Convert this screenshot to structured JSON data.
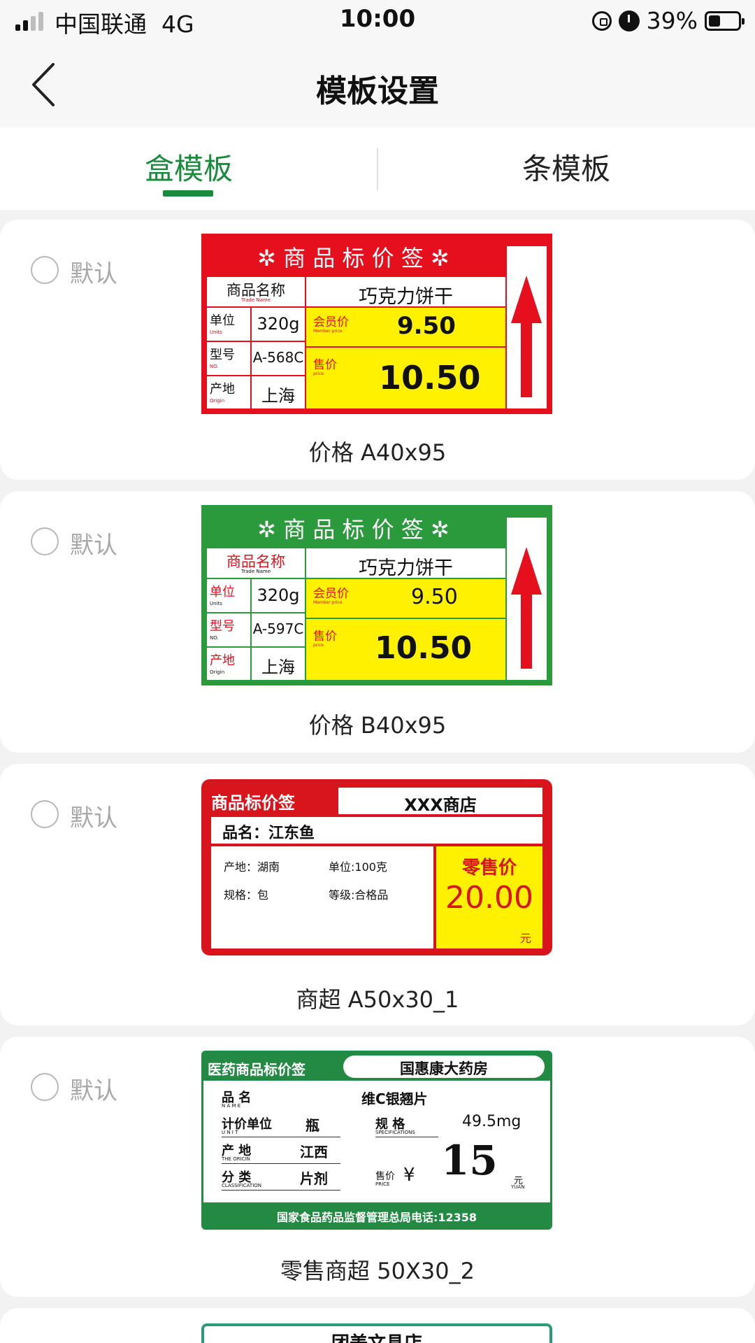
{
  "status_bar": {
    "carrier": "中国联通",
    "network": "4G",
    "time": "10:00",
    "battery": "39%",
    "battery_level": 0.39
  },
  "navbar": {
    "title": "模板设置"
  },
  "tabs": [
    {
      "label": "盒模板",
      "active": true
    },
    {
      "label": "条模板",
      "active": false
    }
  ],
  "radio_label": "默认",
  "templates": [
    {
      "name": "价格 A40x95",
      "label": {
        "header": "商 品 标 价 签",
        "product_name_label": "商品名称",
        "product_name_en": "Trade Name",
        "product_name": "巧克力饼干",
        "unit_label": "单位",
        "unit_en": "Units",
        "unit": "320g",
        "model_label": "型号",
        "model_en": "NO.",
        "model": "A-568C",
        "origin_label": "产地",
        "origin_en": "Origin",
        "origin": "上海",
        "member_price_label": "会员价",
        "member_price_en": "Member price",
        "member_price": "9.50",
        "price_label": "售价",
        "price_en": "price",
        "price": "10.50",
        "theme_color": "#e60f1d"
      }
    },
    {
      "name": "价格 B40x95",
      "label": {
        "header": "商 品 标 价 签",
        "product_name_label": "商品名称",
        "product_name_en": "Trade Name",
        "product_name": "巧克力饼干",
        "unit_label": "单位",
        "unit_en": "Units",
        "unit": "320g",
        "model_label": "型号",
        "model_en": "NO.",
        "model": "A-597C",
        "origin_label": "产地",
        "origin_en": "Origin",
        "origin": "上海",
        "member_price_label": "会员价",
        "member_price_en": "Member price",
        "member_price": "9.50",
        "price_label": "售价",
        "price_en": "price",
        "price": "10.50",
        "theme_color": "#2a9a3c"
      }
    },
    {
      "name": "商超 A50x30_1",
      "label": {
        "header": "商品标价签",
        "store": "XXX商店",
        "product_name": "品名：江东鱼",
        "origin": "产地：湖南",
        "unit": "单位:100克",
        "spec": "规格：包",
        "grade": "等级:合格品",
        "price_label": "零售价",
        "price": "20.00",
        "currency": "元",
        "theme_color": "#d8141d"
      }
    },
    {
      "name": "零售商超 50X30_2",
      "label": {
        "header": "医药商品标价签",
        "store": "国惠康大药房",
        "name_label": "品  名",
        "name_en": "N A M E",
        "name": "维C银翘片",
        "unit_label": "计价单位",
        "unit_en": "U N I T",
        "unit": "瓶",
        "origin_label": "产   地",
        "origin_en": "THE ORICIN",
        "origin": "江西",
        "class_label": "分   类",
        "class_en": "CLASSIFICATION",
        "class": "片剂",
        "spec_label": "规   格",
        "spec_en": "SPECIFICATIONS",
        "spec": "49.5mg",
        "price_label": "售价",
        "price_en": "PRICE",
        "yen": "¥",
        "price": "15",
        "currency": "元",
        "currency_en": "YUAN",
        "footer": "国家食品药品监督管理总局电话:12358",
        "theme_color": "#238a43"
      }
    },
    {
      "label": {
        "store": "团美文具店",
        "theme_color": "#2a9a7a"
      }
    }
  ]
}
